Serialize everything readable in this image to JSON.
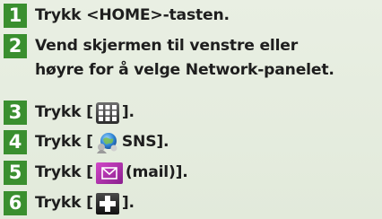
{
  "steps": [
    {
      "num": "1",
      "text": "Trykk <HOME>-tasten."
    },
    {
      "num": "2",
      "line1": "Vend skjermen til venstre eller",
      "line2": "høyre for å velge Network-panelet."
    },
    {
      "num": "3",
      "prefix": "Trykk [",
      "suffix": "].",
      "icon": "grid-icon"
    },
    {
      "num": "4",
      "prefix": "Trykk [",
      "suffix": "SNS].",
      "icon": "sns-globe-icon"
    },
    {
      "num": "5",
      "prefix": "Trykk [",
      "suffix": "(mail)].",
      "icon": "mail-envelope-icon"
    },
    {
      "num": "6",
      "prefix": "Trykk [",
      "suffix": "].",
      "icon": "plus-icon"
    }
  ],
  "colors": {
    "step_badge": "#3a8f2f",
    "background": "#e4ecdc",
    "text": "#1e1e1e"
  }
}
